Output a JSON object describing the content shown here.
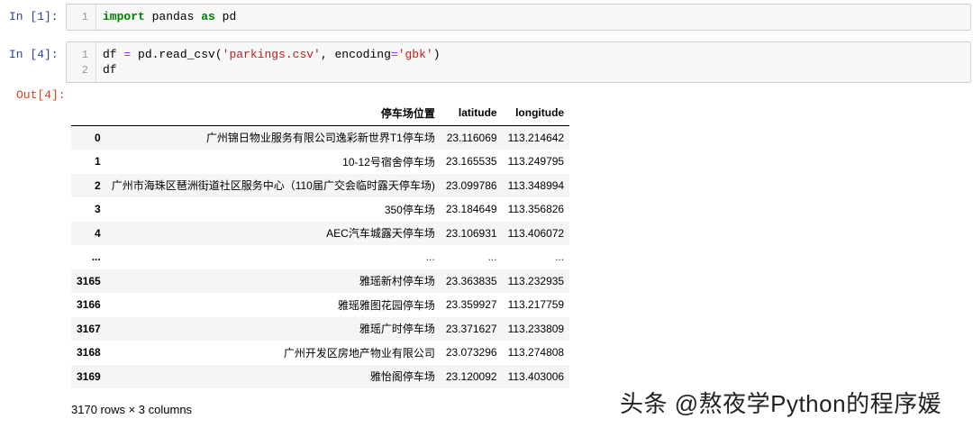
{
  "cells": [
    {
      "prompt": "In  [1]:",
      "lines": [
        {
          "n": "1",
          "parts": [
            [
              "kw",
              "import"
            ],
            [
              "t",
              " pandas "
            ],
            [
              "kw",
              "as"
            ],
            [
              "t",
              " pd"
            ]
          ]
        }
      ]
    },
    {
      "prompt": "In  [4]:",
      "lines": [
        {
          "n": "1",
          "parts": [
            [
              "t",
              "df "
            ],
            [
              "op",
              "="
            ],
            [
              "t",
              " pd.read_csv("
            ],
            [
              "str",
              "'parkings.csv'"
            ],
            [
              "t",
              ", encoding"
            ],
            [
              "op",
              "="
            ],
            [
              "str",
              "'gbk'"
            ],
            [
              "t",
              ")"
            ]
          ]
        },
        {
          "n": "2",
          "parts": [
            [
              "t",
              "df"
            ]
          ]
        }
      ]
    }
  ],
  "output": {
    "prompt": "Out[4]:",
    "columns": [
      "",
      "停车场位置",
      "latitude",
      "longitude"
    ],
    "rows": [
      [
        "0",
        "广州锦日物业服务有限公司逸彩新世界T1停车场",
        "23.116069",
        "113.214642"
      ],
      [
        "1",
        "10-12号宿舍停车场",
        "23.165535",
        "113.249795"
      ],
      [
        "2",
        "广州市海珠区琶洲街道社区服务中心（110届广交会临时露天停车场)",
        "23.099786",
        "113.348994"
      ],
      [
        "3",
        "350停车场",
        "23.184649",
        "113.356826"
      ],
      [
        "4",
        "AEC汽车城露天停车场",
        "23.106931",
        "113.406072"
      ],
      [
        "...",
        "...",
        "...",
        "..."
      ],
      [
        "3165",
        "雅瑶新村停车场",
        "23.363835",
        "113.232935"
      ],
      [
        "3166",
        "雅瑶雅图花园停车场",
        "23.359927",
        "113.217759"
      ],
      [
        "3167",
        "雅瑶广时停车场",
        "23.371627",
        "113.233809"
      ],
      [
        "3168",
        "广州开发区房地产物业有限公司",
        "23.073296",
        "113.274808"
      ],
      [
        "3169",
        "雅怡阁停车场",
        "23.120092",
        "113.403006"
      ]
    ],
    "shape": "3170 rows × 3 columns"
  },
  "watermark": "头条 @熬夜学Python的程序媛"
}
